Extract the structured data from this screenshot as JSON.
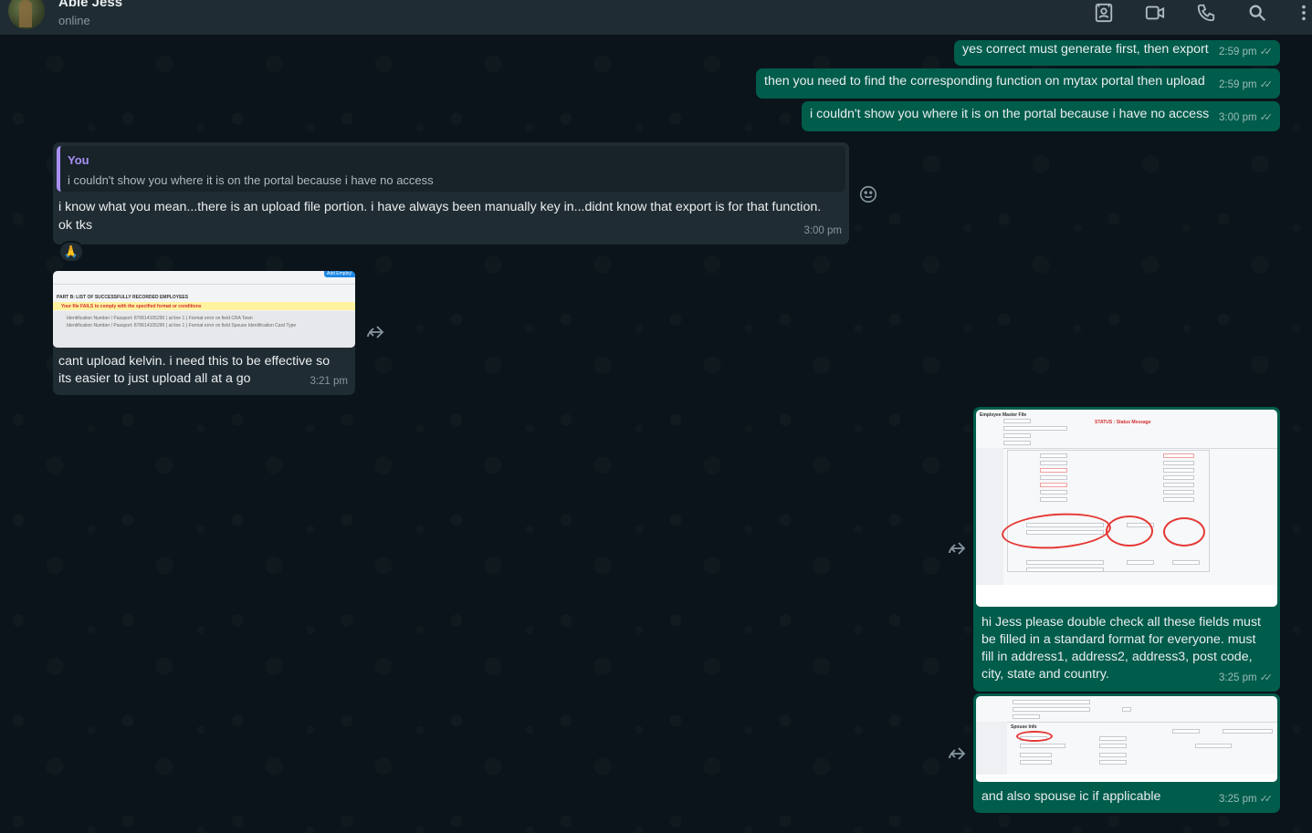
{
  "header": {
    "contact_name": "Able Jess",
    "status": "online"
  },
  "messages": [
    {
      "text": "yes correct must generate first, then export",
      "time": "2:59 pm"
    },
    {
      "text": "then you need to find the corresponding function on mytax portal then upload",
      "time": "2:59 pm"
    },
    {
      "text": "i couldn't show you where it is on the portal because i have no access",
      "time": "3:00 pm"
    },
    {
      "reply_author": "You",
      "reply_text": "i couldn't show you where it is on the portal because i have no access",
      "text_line1": "i know what you mean...there is an upload file portion.  i have always been manually key in...didnt know that export is for that function.",
      "text_line2": "ok tks",
      "time": "3:00 pm",
      "reaction": "🙏"
    },
    {
      "image_title": "PART B: LIST OF SUCCESSFULLY RECORDED EMPLOYEES",
      "image_error": "Your file FAILS to comply with the specified format or conditions",
      "image_btn": "Add Employ",
      "image_row1": "Identification Number / Passport: 870614105290 (  at line  1 ) Format error on field  CRA Town",
      "image_row2": "Identification Number / Passport: 870614105290 (  at line  1 ) Format error on field  Spouse Identification Card Type",
      "text_line1": "cant upload kelvin.  i need this to be effective so",
      "text_line2": "its easier to just upload all at a go",
      "time": "3:21 pm"
    },
    {
      "image_title": "Employee Master File",
      "image_status": "STATUS : Status Message",
      "text_line1": "hi Jess please double check all these fields must",
      "text_line2": "be filled in a standard format for everyone. must",
      "text_line3": "fill in address1, address2, address3, post code,",
      "text_line4": "city, state and country.",
      "time": "3:25 pm"
    },
    {
      "image_label": "Spouse Info",
      "text": "and also spouse ic if applicable",
      "time": "3:25 pm"
    }
  ],
  "icons": {
    "contacts": "contact-card-icon",
    "video": "video-camera-icon",
    "call": "phone-icon",
    "search": "search-icon",
    "menu": "kebab-menu-icon",
    "forward": "forward-icon",
    "emoji": "emoji-icon",
    "read": "double-check-icon"
  },
  "colors": {
    "background": "#0b141a",
    "outgoing_bubble": "#005c4b",
    "incoming_bubble": "#202c33",
    "reply_accent": "#a791f3"
  }
}
